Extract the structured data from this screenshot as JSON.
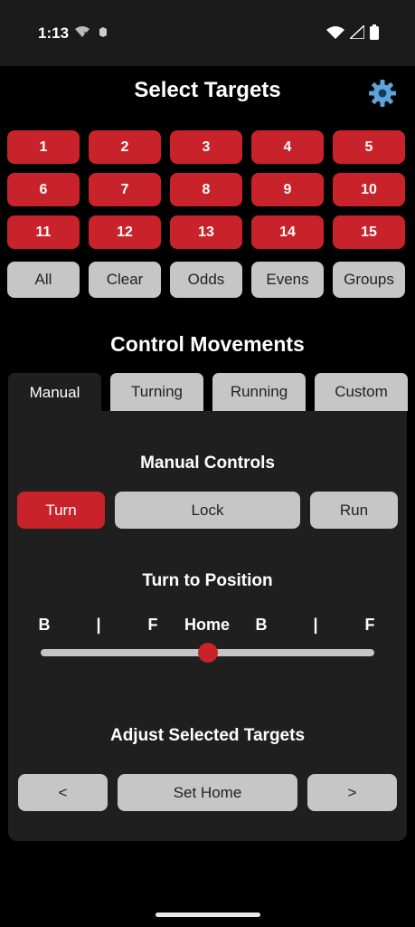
{
  "status": {
    "time": "1:13"
  },
  "header": {
    "title": "Select Targets"
  },
  "targets": [
    "1",
    "2",
    "3",
    "4",
    "5",
    "6",
    "7",
    "8",
    "9",
    "10",
    "11",
    "12",
    "13",
    "14",
    "15"
  ],
  "groups": [
    "All",
    "Clear",
    "Odds",
    "Evens",
    "Groups"
  ],
  "control": {
    "title": "Control Movements",
    "tabs": [
      "Manual",
      "Turning",
      "Running",
      "Custom"
    ],
    "active_tab": "Manual"
  },
  "manual": {
    "heading": "Manual Controls",
    "buttons": [
      "Turn",
      "Lock",
      "Run"
    ]
  },
  "turn_to_position": {
    "heading": "Turn to Position",
    "labels": [
      "B",
      "|",
      "F",
      "Home",
      "B",
      "|",
      "F"
    ],
    "slider_value": 0.5
  },
  "adjust": {
    "heading": "Adjust Selected Targets",
    "buttons": [
      "<",
      "Set Home",
      ">"
    ]
  },
  "colors": {
    "accent": "#c8232a",
    "button_gray": "#c6c6c6",
    "panel": "#1f1f1f"
  },
  "icons": {
    "settings": "gear-icon"
  }
}
